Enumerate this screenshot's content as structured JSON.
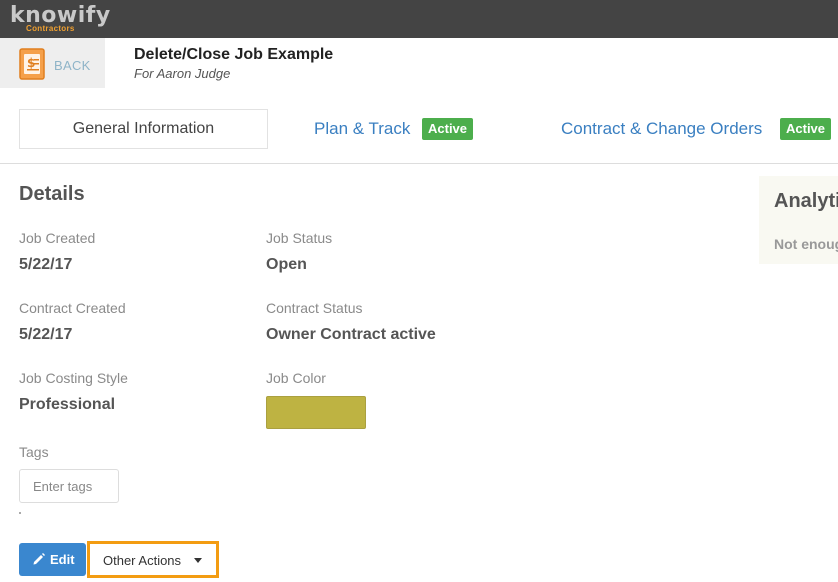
{
  "app": {
    "logo_text": "knowify",
    "logo_sub": "Contractors"
  },
  "header": {
    "back_label": "BACK",
    "title": "Delete/Close Job Example",
    "subtitle": "For Aaron Judge"
  },
  "tabs": {
    "general": "General Information",
    "plan": "Plan & Track",
    "plan_badge": "Active",
    "contract": "Contract & Change Orders",
    "contract_badge": "Active"
  },
  "details": {
    "title": "Details",
    "job_created_label": "Job Created",
    "job_created_value": "5/22/17",
    "job_status_label": "Job Status",
    "job_status_value": "Open",
    "contract_created_label": "Contract Created",
    "contract_created_value": "5/22/17",
    "contract_status_label": "Contract Status",
    "contract_status_value": "Owner Contract active",
    "costing_style_label": "Job Costing Style",
    "costing_style_value": "Professional",
    "job_color_label": "Job Color",
    "job_color": "#beb342",
    "tags_label": "Tags",
    "tags_placeholder": "Enter tags"
  },
  "actions": {
    "edit_label": "Edit",
    "other_label": "Other Actions"
  },
  "analytics": {
    "title": "Analytics",
    "text": "Not enough data"
  },
  "colors": {
    "topbar": "#444444",
    "link": "#3a7fc1",
    "active_badge": "#4cae4c",
    "primary_button": "#3a87cf",
    "highlight": "#f39c12"
  }
}
